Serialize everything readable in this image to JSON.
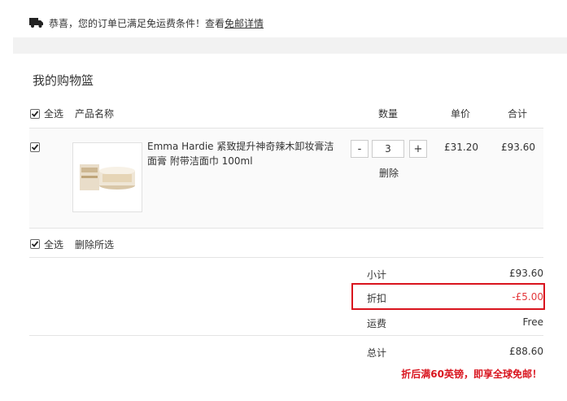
{
  "notice": {
    "text": "恭喜，您的订单已满足免运费条件！查看",
    "link": "免邮详情"
  },
  "cart": {
    "title": "我的购物篮",
    "header": {
      "select_all": "全选",
      "product_name": "产品名称",
      "quantity": "数量",
      "unit_price": "单价",
      "total": "合计"
    },
    "items": [
      {
        "name": "Emma Hardie 紧致提升神奇辣木卸妆膏洁面膏 附带洁面巾 100ml",
        "quantity": "3",
        "minus": "-",
        "plus": "+",
        "delete": "删除",
        "unit_price": "£31.20",
        "line_total": "£93.60"
      }
    ],
    "footer": {
      "select_all": "全选",
      "delete_selected": "删除所选"
    },
    "summary": {
      "subtotal_label": "小计",
      "subtotal_value": "£93.60",
      "discount_label": "折扣",
      "discount_value": "-£5.00",
      "shipping_label": "运费",
      "shipping_value": "Free",
      "total_label": "总计",
      "total_value": "£88.60"
    },
    "promo": "折后满60英镑，即享全球免邮！"
  },
  "colors": {
    "accent_red": "#d9141e",
    "discount_red": "#e4393c"
  },
  "icons": {
    "truck": "truck-icon",
    "checkbox": "checkbox-checked-icon"
  }
}
